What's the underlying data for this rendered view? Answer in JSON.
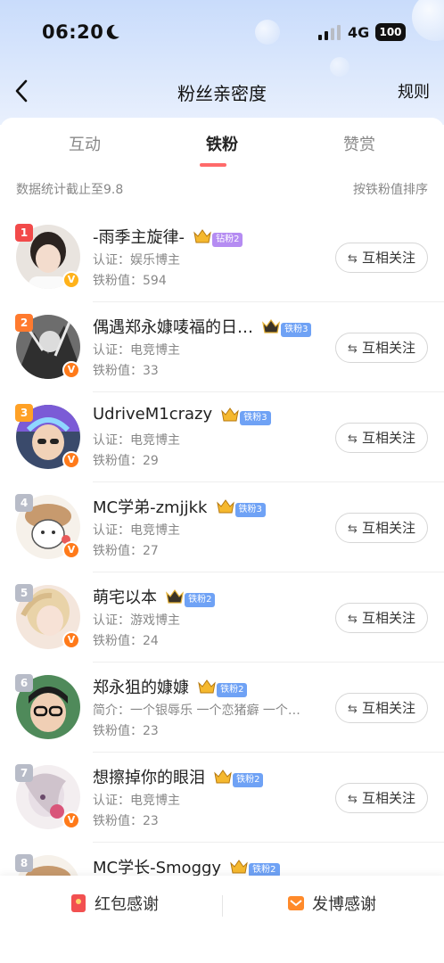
{
  "status": {
    "time": "06:20",
    "network": "4G",
    "battery": "100"
  },
  "nav": {
    "title": "粉丝亲密度",
    "rules": "规则"
  },
  "tabs": [
    {
      "label": "互动",
      "active": false
    },
    {
      "label": "铁粉",
      "active": true
    },
    {
      "label": "赞赏",
      "active": false
    }
  ],
  "stats_note": "数据统计截止至9.8",
  "sort_label": "按铁粉值排序",
  "fans": [
    {
      "rank": "1",
      "name": "-雨季主旋律-",
      "badge": "钻粉2",
      "line1": "认证：娱乐博主",
      "line2": "铁粉值：594",
      "button": "互相关注"
    },
    {
      "rank": "2",
      "name": "偶遇郑永嫝唛福的日…",
      "badge": "铁粉3",
      "line1": "认证：电竞博主",
      "line2": "铁粉值：33",
      "button": "互相关注"
    },
    {
      "rank": "3",
      "name": "UdriveM1crazy",
      "badge": "铁粉3",
      "line1": "认证：电竞博主",
      "line2": "铁粉值：29",
      "button": "互相关注"
    },
    {
      "rank": "4",
      "name": "MC学弟-zmjjkk",
      "badge": "铁粉3",
      "line1": "认证：电竞博主",
      "line2": "铁粉值：27",
      "button": "互相关注"
    },
    {
      "rank": "5",
      "name": "萌宅以本",
      "badge": "铁粉2",
      "line1": "认证：游戏博主",
      "line2": "铁粉值：24",
      "button": "互相关注"
    },
    {
      "rank": "6",
      "name": "郑永狙的嫝嫝",
      "badge": "铁粉2",
      "line1": "简介：一个银辱乐 一个恋猪癖 一个…",
      "line2": "铁粉值：23",
      "button": "互相关注"
    },
    {
      "rank": "7",
      "name": "想擦掉你的眼泪",
      "badge": "铁粉2",
      "line1": "认证：电竞博主",
      "line2": "铁粉值：23",
      "button": "互相关注"
    },
    {
      "rank": "8",
      "name": "MC学长-Smoggy",
      "badge": "铁粉2",
      "line1": "",
      "line2": "",
      "button": ""
    }
  ],
  "bottom": {
    "red_packet": "红包感谢",
    "post_thanks": "发博感谢"
  },
  "colors": {
    "rank1": "#f24a4a",
    "rank2": "#ff7a2e",
    "rank3": "#ffa126",
    "rank_other": "#b8bcc8",
    "badge_diamond": "#b58cf2",
    "badge_iron": "#6fa2f5",
    "verified": "#ff7a1a",
    "accent": "#ff6a6a"
  },
  "icons": [
    "back-arrow-icon",
    "moon-icon",
    "signal-icon",
    "battery-icon",
    "mutual-follow-icon",
    "red-packet-icon",
    "post-icon",
    "crown-icon"
  ]
}
